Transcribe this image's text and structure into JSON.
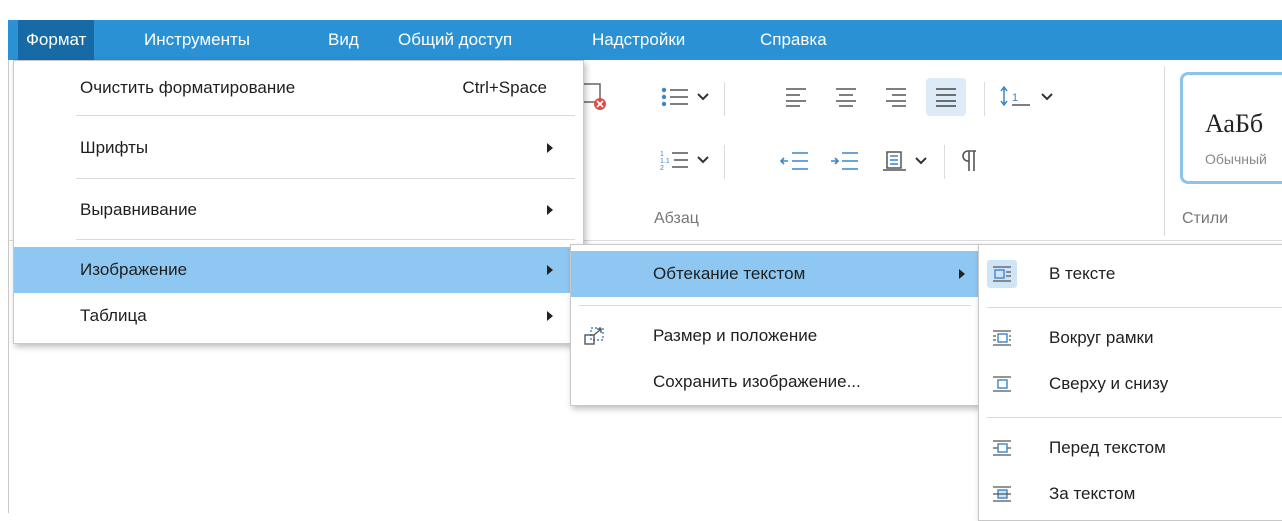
{
  "menubar": {
    "items": [
      {
        "label": "Формат",
        "active": true
      },
      {
        "label": "Инструменты",
        "active": false
      },
      {
        "label": "Вид",
        "active": false
      },
      {
        "label": "Общий доступ",
        "active": false
      },
      {
        "label": "Надстройки",
        "active": false
      },
      {
        "label": "Справка",
        "active": false
      }
    ]
  },
  "ribbon": {
    "paragraph_label": "Абзац",
    "styles_label": "Стили",
    "style_sample": "АаБб",
    "style_name": "Обычный"
  },
  "format_menu": {
    "items": [
      {
        "label": "Очистить форматирование",
        "shortcut": "Ctrl+Space"
      },
      {
        "label": "Шрифты",
        "submenu": true
      },
      {
        "label": "Выравнивание",
        "submenu": true
      },
      {
        "label": "Изображение",
        "submenu": true,
        "highlighted": true
      },
      {
        "label": "Таблица",
        "submenu": true
      }
    ]
  },
  "image_menu": {
    "items": [
      {
        "label": "Обтекание текстом",
        "submenu": true,
        "highlighted": true
      },
      {
        "label": "Размер и положение",
        "icon": "resize-icon"
      },
      {
        "label": "Сохранить изображение..."
      }
    ]
  },
  "wrap_menu": {
    "items": [
      {
        "label": "В тексте",
        "icon": "wrap-inline-icon",
        "selected": true
      },
      {
        "label": "Вокруг рамки",
        "icon": "wrap-square-icon"
      },
      {
        "label": "Сверху и снизу",
        "icon": "wrap-top-bottom-icon"
      },
      {
        "label": "Перед текстом",
        "icon": "wrap-in-front-icon"
      },
      {
        "label": "За текстом",
        "icon": "wrap-behind-icon"
      }
    ]
  },
  "colors": {
    "menubar": "#2a91d4",
    "menubar_active": "#166ba7",
    "highlight": "#8ec8f2",
    "icon_blue": "#3a86c8"
  }
}
